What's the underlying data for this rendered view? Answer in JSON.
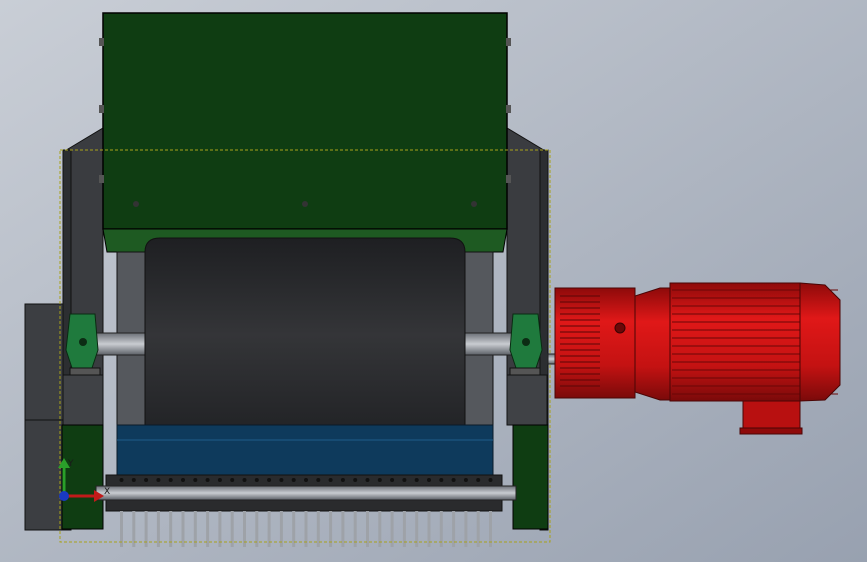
{
  "viewport": {
    "background_top": "#c7ccd4",
    "background_bottom": "#9aa3b2"
  },
  "colors": {
    "hopper": "#0f3d12",
    "hopper_edge": "#000000",
    "frame": "#3a3c40",
    "drum": "#2d2e31",
    "belt": "#123a5a",
    "bearing": "#1f7a3d",
    "motor": "#c41212",
    "motor_dark": "#7a0a0a",
    "side_panel": "#0f3d12",
    "rake": "#303030",
    "outline": "#a8a21a"
  },
  "triad": {
    "x_label": "X",
    "y_label": "Y",
    "x_color": "#c21a1a",
    "y_color": "#2aa02a",
    "z_color": "#1a3ac2"
  }
}
